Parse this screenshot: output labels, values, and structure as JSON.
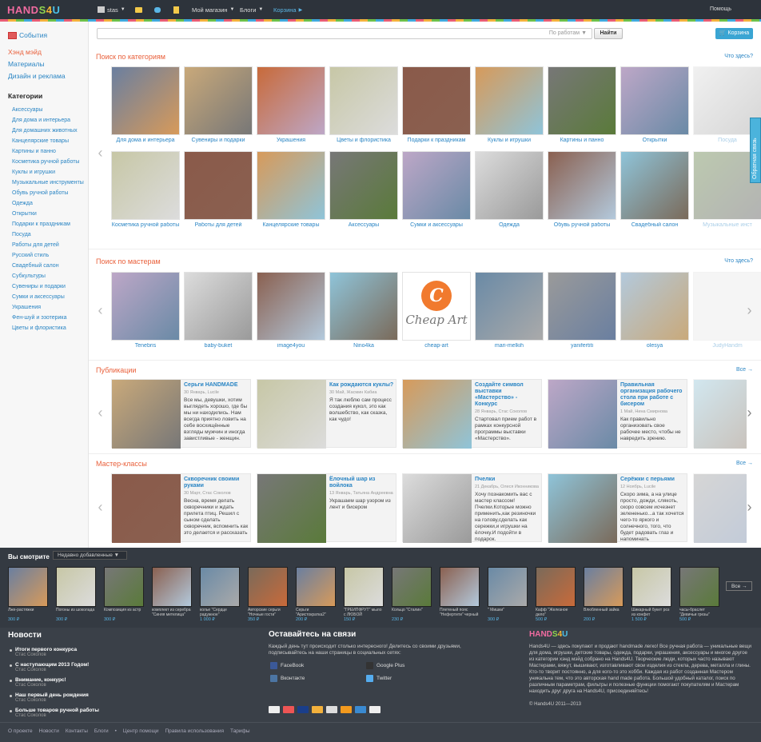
{
  "topbar": {
    "logo_a": "HAND",
    "logo_b": "S",
    "logo_c": "4",
    "logo_d": "U",
    "user": "stas",
    "shop": "Мой магазин",
    "blogs": "Блоги",
    "cart": "Корзина",
    "help": "Помощь"
  },
  "search": {
    "placeholder": "",
    "scope": "По работам",
    "button": "Найти",
    "cart": "Корзина"
  },
  "sidebar": {
    "events": "События",
    "handmade": "Хэнд мэйд",
    "materials": "Материалы",
    "design": "Дизайн и реклама",
    "categories_title": "Категории",
    "categories": [
      "Аксессуары",
      "Для дома и интерьера",
      "Для домашних животных",
      "Канцелярские товары",
      "Картины и панно",
      "Косметика ручной работы",
      "Куклы и игрушки",
      "Музыкальные инструменты",
      "Обувь ручной работы",
      "Одежда",
      "Открытки",
      "Подарки к праздникам",
      "Посуда",
      "Работы для детей",
      "Русский стиль",
      "Свадебный салон",
      "Субкультуры",
      "Сувениры и подарки",
      "Сумки и аксессуары",
      "Украшения",
      "Фен-шуй и эзотерика",
      "Цветы и флористика"
    ]
  },
  "feedback": "Обратная связь",
  "sections": {
    "categories": "Поиск по категориям",
    "masters": "Поиск по мастерам",
    "publications": "Публикации",
    "masterclasses": "Мастер-классы",
    "hint": "Что здесь?",
    "all": "Все →"
  },
  "cat_row1": [
    "Для дома и интерьера",
    "Сувениры и подарки",
    "Украшения",
    "Цветы и флористика",
    "Подарки к праздникам",
    "Куклы и игрушки",
    "Картины и панно",
    "Открытки",
    "Посуда"
  ],
  "cat_row2": [
    "Косметика ручной работы",
    "Работы для детей",
    "Канцелярские товары",
    "Аксессуары",
    "Сумки и аксессуары",
    "Одежда",
    "Обувь ручной работы",
    "Свадебный салон",
    "Музыкальные инст"
  ],
  "masters": [
    "Tenebris",
    "baby-buket",
    "image4you",
    "Nino4ka",
    "cheap-art",
    "mari-melkih",
    "yanifertiti",
    "olesya",
    "JudyHandm"
  ],
  "cheap_art": "Cheap Art",
  "publications": [
    {
      "title": "Серьги HANDMADE",
      "meta": "30 Январь, Lucile",
      "desc": "Все мы, девушки, хотим выглядеть хорошо, где бы мы ни находились. Нам всегда приятно ловить на себе восхищённые взгляды мужчин и иногда завистливые - женщин."
    },
    {
      "title": "Как рождаются куклы?",
      "meta": "30 Май, Жасмин Кабиа",
      "desc": "Я так люблю сам процесс создания кукол, это как волшебство, как сказка, как чудо!"
    },
    {
      "title": "Создайте символ выставки «Мастерство» - Конкурс",
      "meta": "28 Январь, Стас Соколов",
      "desc": "Стартовал прием работ в рамках конкурсной программы выставки «Мастерство»."
    },
    {
      "title": "Правильная организация рабочего стола при работе с бисером",
      "meta": "1 Май, Нина Смирнова",
      "desc": "Как правильно организовать свое рабочее место, чтобы не навредить зрению."
    }
  ],
  "masterclasses": [
    {
      "title": "Скворечник своими руками",
      "meta": "30 Март, Стас Соколов",
      "desc": "Весна, время делать скворечники и ждать прилета птиц. Решил с сыном сделать скворечник, вспомнить как это делается и рассказать"
    },
    {
      "title": "Ёлочный шар из войлока",
      "meta": "13 Январь, Татьяна Андреевна",
      "desc": "Украшаем шар узором из лент и бисером"
    },
    {
      "title": "Пчелки",
      "meta": "21 Декабрь, Олеся Иконникова",
      "desc": "Хочу познакомить вас с мастер классом! Пчелки.Которые можно применить,как резиночки на голову,сделать как сережки,и игрушки на ёлочку.И подойти в подарок."
    },
    {
      "title": "Серёжки с перьями",
      "meta": "12 Ноябрь, Lucile",
      "desc": "Скоро зима, а на улице просто, дожди, слякоть, скоро совсем исчезнет зелененько...а так хочется чего-то яркого и солнечного, того, что будет радовать глаз и напоминать"
    }
  ],
  "viewed": {
    "title": "Вы смотрите",
    "select": "Недавно добавленные",
    "more": "Все →",
    "items": [
      {
        "n": "Лже-растяжки",
        "p": "300 ₽"
      },
      {
        "n": "Погоны из шоколада",
        "p": "300 ₽"
      },
      {
        "n": "Композиция из астр",
        "p": "300 ₽"
      },
      {
        "n": "комплект из серебра \"Синяя метелица\"",
        "p": ""
      },
      {
        "n": "колье \"Сердце радужное\"",
        "p": "1 000 ₽"
      },
      {
        "n": "Авторские серьги \"Ночные гости\"",
        "p": "350 ₽"
      },
      {
        "n": "Серьги \"Аристократка2\"",
        "p": "200 ₽"
      },
      {
        "n": "\"ГРЕЙПФРУТ\" мыло с ЛЮБОЙ",
        "p": "150 ₽"
      },
      {
        "n": "Кольцо \"Сталин\"",
        "p": "230 ₽"
      },
      {
        "n": "Плетеный пояс \"Нефертити\" черный макраме",
        "p": ""
      },
      {
        "n": "\" Мишки\"",
        "p": "300 ₽"
      },
      {
        "n": "Кафф \"Железное дело\"",
        "p": "500 ₽"
      },
      {
        "n": "Влюбленный зайка",
        "p": "200 ₽"
      },
      {
        "n": "Шикарный букет роз из конфет",
        "p": "1 500 ₽"
      },
      {
        "n": "часы-браслет \"Девичьи грезы\"",
        "p": "500 ₽"
      }
    ]
  },
  "footer": {
    "news_title": "Новости",
    "news": [
      {
        "t": "Итоги первого конкурса",
        "a": "Стас Соколов"
      },
      {
        "t": "С наступающим 2013 Годом!",
        "a": "Стас Соколов"
      },
      {
        "t": "Внимание, конкурс!",
        "a": "Стас Соколов"
      },
      {
        "t": "Наш первый день рождения",
        "a": "Стас Соколов"
      },
      {
        "t": "Больше товаров ручной работы",
        "a": "Стас Соколов"
      }
    ],
    "social_title": "Оставайтесь на связи",
    "social_desc": "Каждый день тут происходит столько интересного! Делитесь со своими друзьями, подписывайтесь на наши страницы в социальных сетях:",
    "facebook": "FaceBook",
    "vk": "Вконтакте",
    "gplus": "Google Plus",
    "twitter": "Twitter",
    "about": "Hands4U — здесь покупают и продают handmade легко! Все ручная работа — уникальные вещи для дома, игрушки, детские товары, одежда, подарки, украшения, аксессуары и многое другое из категории хэнд мэйд собрано на Hands4U. Творческие люди, которых часто называют Мастерами, вяжут, вышивают, изготавливают свои изделия из стекла, дерева, металла и глины. Кто-то творит постоянно, а для кого-то это хобби. Каждая из работ созданная Мастером уникальна тем, что это авторская hand made работа. Большой удобный каталог, поиск по различным параметрам, фильтры и полезные функции помогают покупателям и Мастерам находить друг друга на Hands4U, присоединяйтесь!",
    "copyright": "© Hands4U 2011—2013",
    "links": [
      "О проекте",
      "Новости",
      "Контакты",
      "Блоги",
      "•",
      "Центр помощи",
      "Правила использования",
      "Тарифы"
    ]
  },
  "colors": {
    "accent": "#e9603b",
    "link": "#2a85c4",
    "dark": "#2d333b"
  }
}
